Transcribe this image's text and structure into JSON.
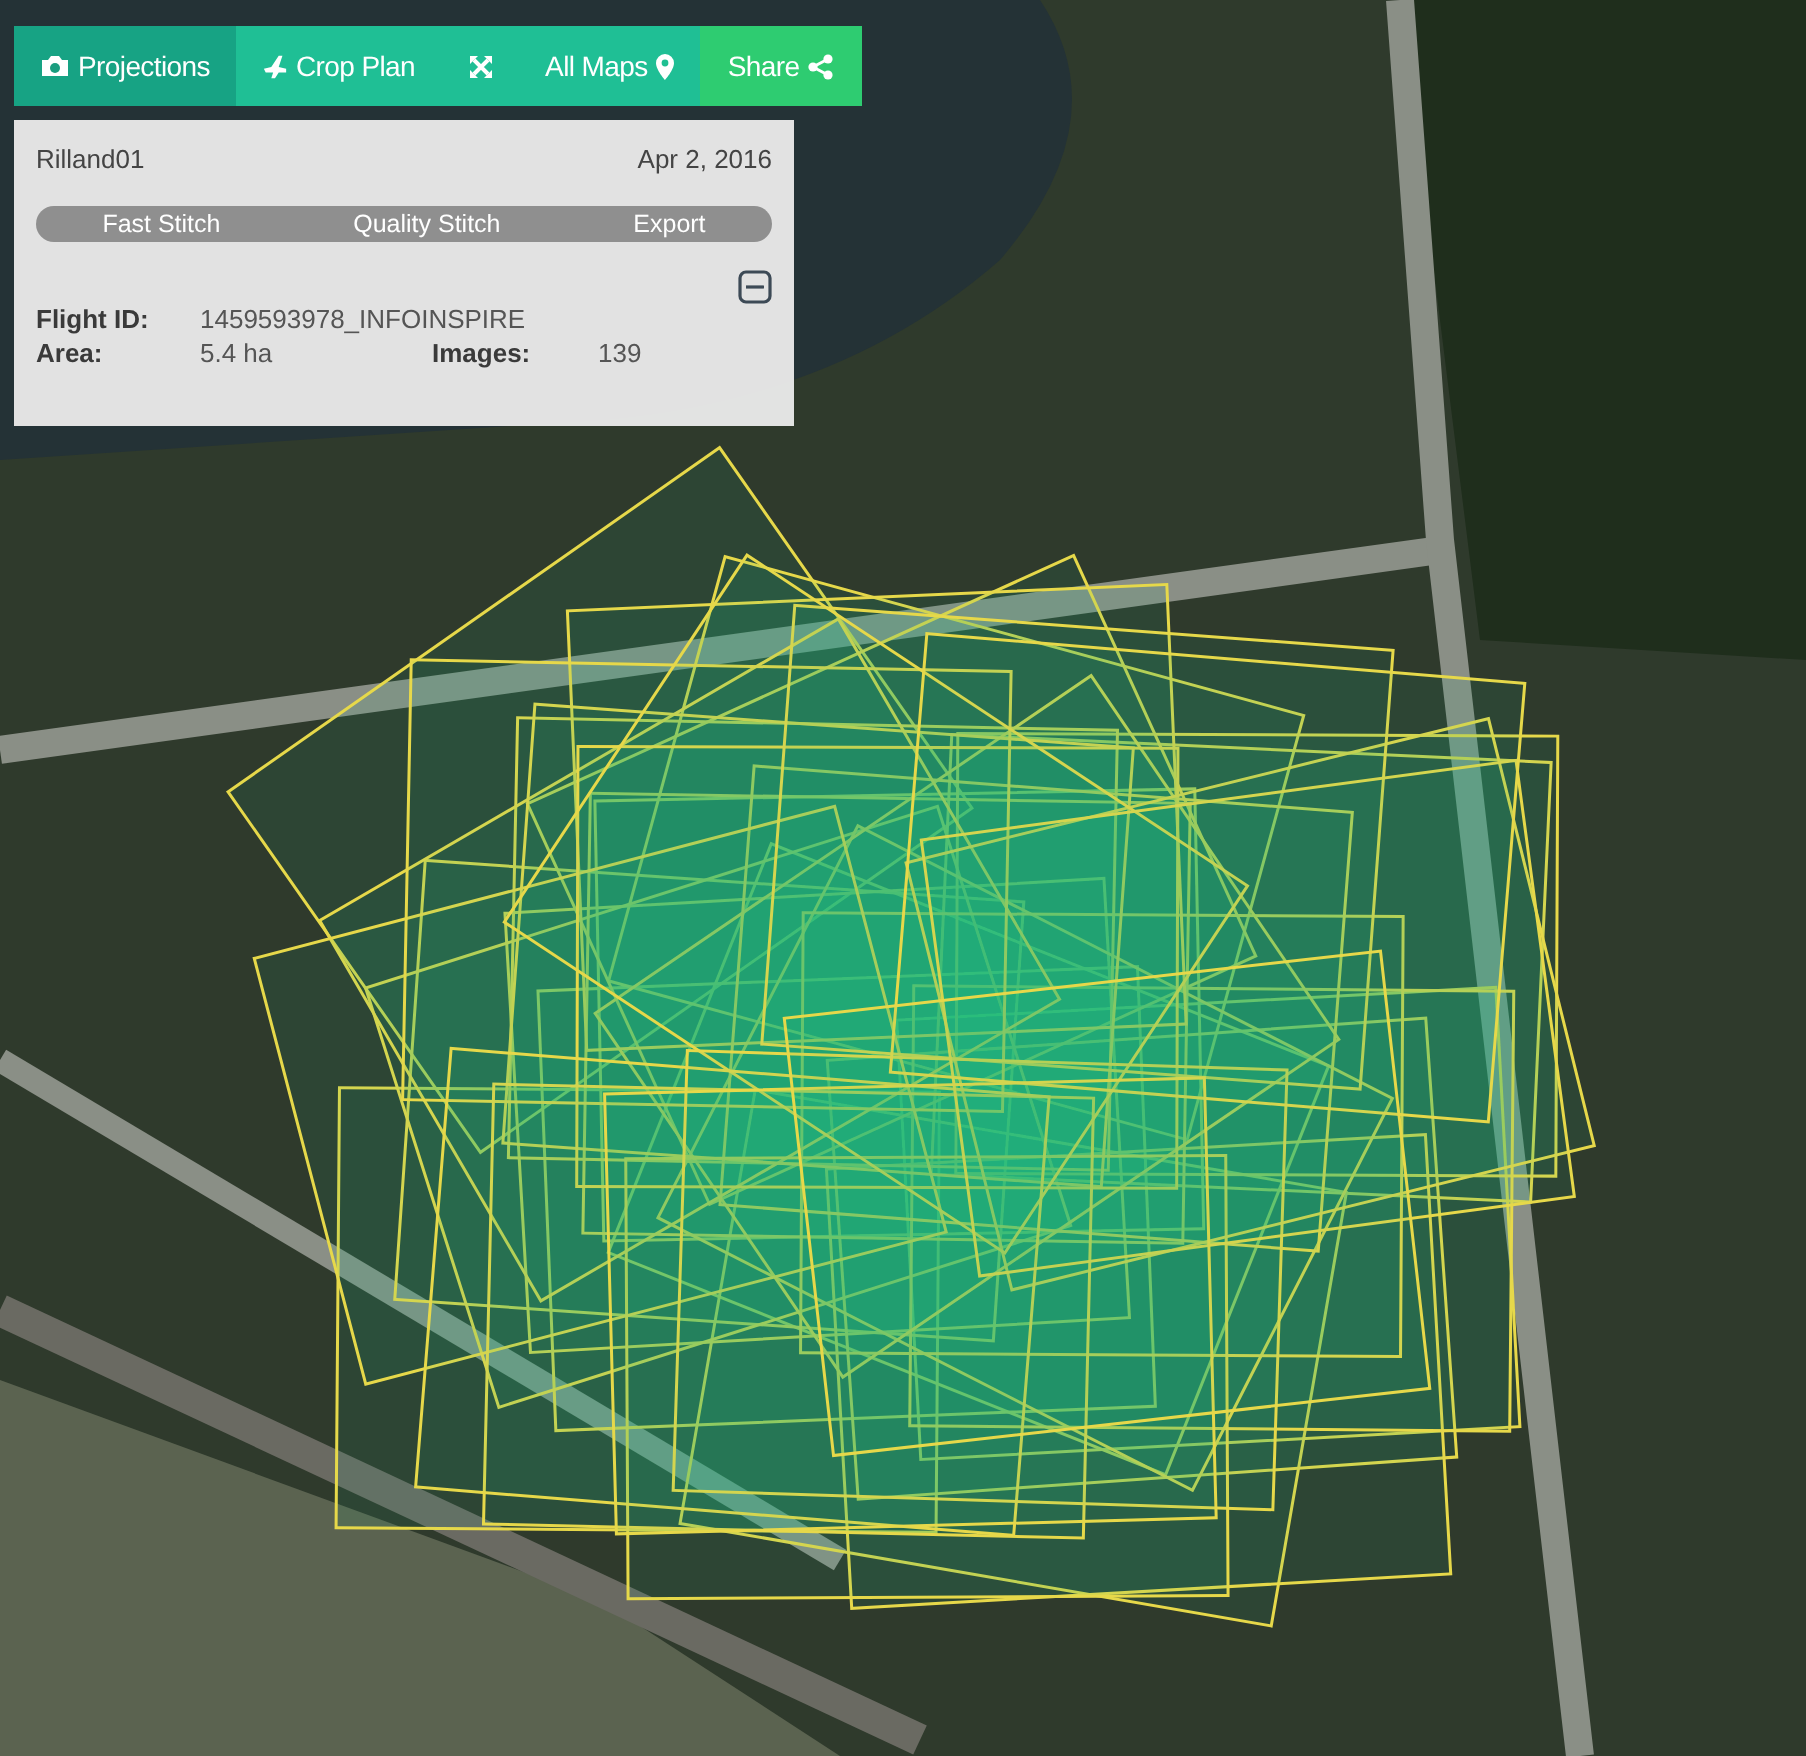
{
  "toolbar": [
    {
      "kind": "tab",
      "label": "Projections",
      "selected": true
    },
    {
      "kind": "tab",
      "label": "Crop Plan",
      "selected": false
    },
    {
      "kind": "icon",
      "selected": false
    },
    {
      "kind": "tab",
      "label": "All Maps",
      "selected": false
    },
    {
      "kind": "share",
      "label": "Share",
      "selected": false
    }
  ],
  "flight_panel": {
    "name": "Rilland01",
    "date": "Apr 2, 2016",
    "actions": [
      {
        "label": "Fast Stitch",
        "disabled": true
      },
      {
        "label": "Quality Stitch",
        "disabled": true
      },
      {
        "label": "Export",
        "disabled": true
      }
    ],
    "details": [
      {
        "label": "Flight ID:",
        "value": "1459593978_INFOINSPIRE"
      },
      {
        "label": "Area:",
        "value": "5.4 ha"
      },
      {
        "label": "Images:",
        "value": "139"
      }
    ]
  }
}
